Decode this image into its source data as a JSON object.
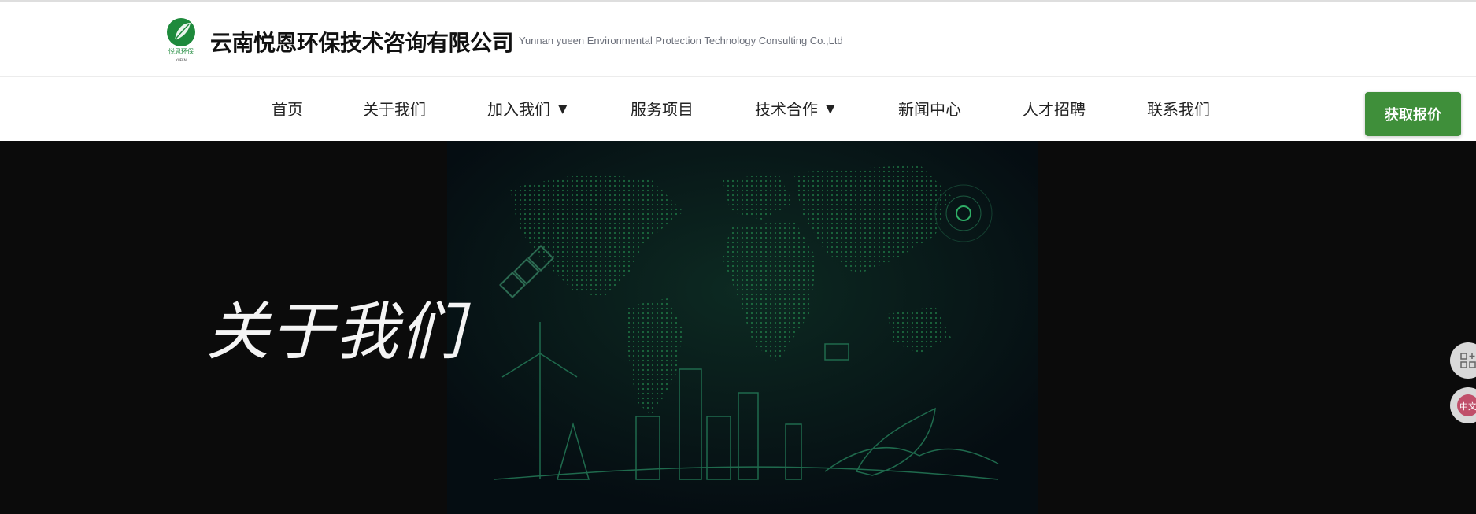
{
  "header": {
    "logo_text": "悦恩环保",
    "logo_subtext": "YUEEN",
    "company_name": "云南悦恩环保技术咨询有限公司",
    "company_name_en": "Yunnan yueen Environmental Protection Technology Consulting Co.,Ltd"
  },
  "nav": {
    "items": [
      {
        "label": "首页"
      },
      {
        "label": "关于我们"
      },
      {
        "label": "加入我们",
        "caret": "▼"
      },
      {
        "label": "服务项目"
      },
      {
        "label": "技术合作",
        "caret": "▼"
      },
      {
        "label": "新闻中心"
      },
      {
        "label": "人才招聘"
      },
      {
        "label": "联系我们"
      }
    ],
    "quote_button": "获取报价"
  },
  "hero": {
    "title": "关于我们"
  },
  "float": {
    "lang_text": "中文"
  },
  "colors": {
    "brand_green": "#3f8f3a",
    "hero_bg": "#0b0b0b",
    "map_glow": "#1f8f4f"
  },
  "icons": [
    "logo-leaf-icon",
    "caret-down-icon",
    "qr-code-icon",
    "translate-icon",
    "satellite-icon",
    "wind-turbine-icon",
    "leaf-icon"
  ]
}
